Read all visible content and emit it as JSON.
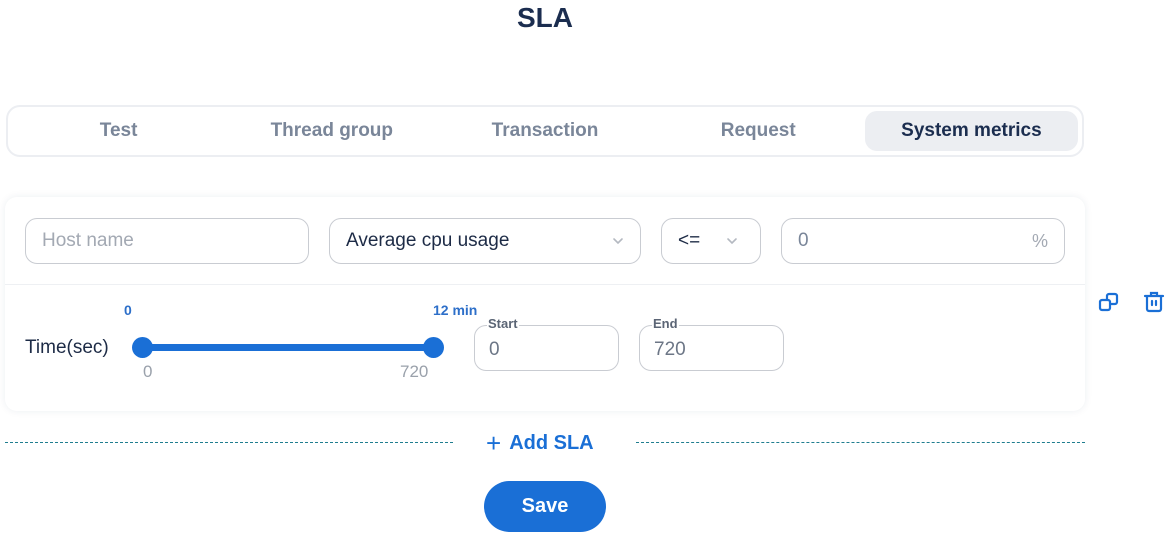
{
  "page": {
    "title": "SLA"
  },
  "tabs": [
    {
      "label": "Test",
      "active": false
    },
    {
      "label": "Thread group",
      "active": false
    },
    {
      "label": "Transaction",
      "active": false
    },
    {
      "label": "Request",
      "active": false
    },
    {
      "label": "System metrics",
      "active": true
    }
  ],
  "sla_item": {
    "host": {
      "placeholder": "Host name",
      "value": ""
    },
    "metric": {
      "selected": "Average cpu usage"
    },
    "operator": {
      "selected": "<="
    },
    "threshold": {
      "value": "0",
      "unit": "%"
    },
    "time": {
      "label": "Time(sec)",
      "top_min_label": "0",
      "top_max_label": "12 min",
      "bottom_min_label": "0",
      "bottom_max_label": "720",
      "range_min": 0,
      "range_max": 720,
      "selected_start": 0,
      "selected_end": 720
    },
    "start": {
      "label": "Start",
      "value": "0"
    },
    "end": {
      "label": "End",
      "value": "720"
    }
  },
  "actions": {
    "copy_icon": "copy-icon",
    "delete_icon": "trash-icon",
    "add_sla_label": "Add SLA",
    "save_label": "Save"
  },
  "colors": {
    "accent": "#1a6fd6",
    "title": "#1b2d4f",
    "tab_inactive": "#7a8699",
    "tab_active_bg": "#eceef2",
    "divider": "#1f7d8f"
  }
}
